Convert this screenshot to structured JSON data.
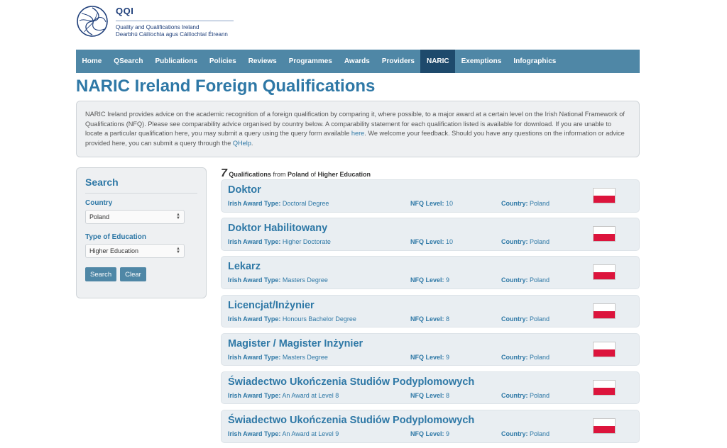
{
  "logo": {
    "abbr": "QQI",
    "english": "Quality and Qualifications Ireland",
    "irish": "Dearbhú Cáilíochta agus Cáilíochtaí Éireann",
    "icon": "swirl-logo-icon",
    "color": "#1f3f7a"
  },
  "nav": {
    "items": [
      {
        "label": "Home"
      },
      {
        "label": "QSearch"
      },
      {
        "label": "Publications"
      },
      {
        "label": "Policies"
      },
      {
        "label": "Reviews"
      },
      {
        "label": "Programmes"
      },
      {
        "label": "Awards"
      },
      {
        "label": "Providers"
      },
      {
        "label": "NARIC",
        "active": true
      },
      {
        "label": "Exemptions"
      },
      {
        "label": "Infographics"
      }
    ],
    "color": "#4f87a6",
    "active_color": "#1e4a6c"
  },
  "page_title": "NARIC Ireland Foreign Qualifications",
  "intro": {
    "text_1": "NARIC Ireland provides advice on the academic recognition of a foreign qualification by comparing it, where possible, to a major award at a certain level on the Irish National Framework of Qualifications (NFQ). Please see comparability advice organised by country below. A comparability statement for each qualification listed is available for download. If you are unable to locate a particular qualification here, you may submit a query using the query form available ",
    "link_1": "here",
    "text_2": ". We welcome your feedback. Should you have any questions on the information or advice provided here, you can submit a query through the ",
    "link_2": "QHelp",
    "text_3": "."
  },
  "search": {
    "title": "Search",
    "country_label": "Country",
    "country_value": "Poland",
    "type_label": "Type of Education",
    "type_value": "Higher Education",
    "search_button": "Search",
    "clear_button": "Clear"
  },
  "results": {
    "count": "7",
    "text_1": "Qualifications",
    "text_2": "from",
    "country": "Poland",
    "text_3": "of",
    "education": "Higher Education",
    "award_type_label": "Irish Award Type:",
    "nfq_label": "NFQ Level:",
    "country_label": "Country:",
    "flag_colors": [
      "#ffffff",
      "#dc143c"
    ],
    "items": [
      {
        "title": "Doktor",
        "award_type": "Doctoral Degree",
        "nfq": "10",
        "country": "Poland"
      },
      {
        "title": "Doktor Habilitowany",
        "award_type": "Higher Doctorate",
        "nfq": "10",
        "country": "Poland"
      },
      {
        "title": "Lekarz",
        "award_type": "Masters Degree",
        "nfq": "9",
        "country": "Poland"
      },
      {
        "title": "Licencjat/Inżynier",
        "award_type": "Honours Bachelor Degree",
        "nfq": "8",
        "country": "Poland"
      },
      {
        "title": "Magister / Magister Inżynier",
        "award_type": "Masters Degree",
        "nfq": "9",
        "country": "Poland"
      },
      {
        "title": "Świadectwo Ukończenia Studiów Podyplomowych",
        "award_type": "An Award at Level 8",
        "nfq": "8",
        "country": "Poland"
      },
      {
        "title": "Świadectwo Ukończenia Studiów Podyplomowych",
        "award_type": "An Award at Level 9",
        "nfq": "9",
        "country": "Poland"
      }
    ]
  }
}
